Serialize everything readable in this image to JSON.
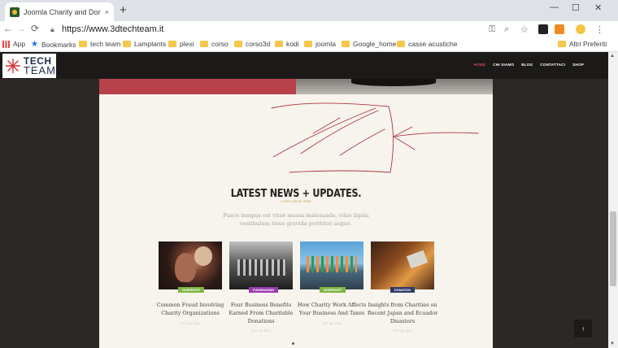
{
  "browser": {
    "tab_title": "Joomla Charity and Donation Te",
    "tab_close": "×",
    "new_tab": "+",
    "window_min": "—",
    "window_max": "☐",
    "window_close": "✕",
    "back": "←",
    "forward": "→",
    "reload": "⟳",
    "url": "https://www.3dtechteam.it",
    "key_icon": "⚿",
    "zoom_icon": "⌕",
    "star_icon": "☆",
    "menu_icon": "⋮"
  },
  "bookmarks": {
    "apps": "App",
    "bookmarks": "Bookmarks",
    "folders": [
      "tech team",
      "Lamplants",
      "plexi",
      "corso",
      "corso3d",
      "kodi",
      "joomla",
      "Google_home",
      "casse acustiche"
    ],
    "other": "Altri Preferiti"
  },
  "site": {
    "logo_line1": "TECH",
    "logo_line2": "TEAM",
    "nav": [
      "HOME",
      "CHI SIAMO",
      "BLOG",
      "CONTATTACI",
      "SHOP"
    ],
    "section_title": "LATEST NEWS + UPDATES.",
    "section_subtitle": "Lorem ipsum dolor",
    "section_desc": "Fusce tempus est vitae massa malesuada, vitae ligula vestibulum risus gravida porttitor augue.",
    "cards": [
      {
        "badge": "NONPROFIT",
        "badge_color": "#7eb641",
        "title": "Common Fraud Involving Charity Organizations",
        "date": "OCT 16, 2014"
      },
      {
        "badge": "FUNDRAISING",
        "badge_color": "#9a3ab0",
        "title": "Four Business Benefits Earned From Charitable Donations",
        "date": "OCT 16, 2014"
      },
      {
        "badge": "NONPROFIT",
        "badge_color": "#7eb641",
        "title": "How Charity Work Affects Your Business And Taxes",
        "date": "OCT 16, 2014"
      },
      {
        "badge": "DONATION",
        "badge_color": "#2f3b66",
        "title": "Insights from Charities on Recent Japan and Ecuador Disasters",
        "date": "OCT 16, 2014"
      }
    ],
    "back_to_top": "↑"
  }
}
